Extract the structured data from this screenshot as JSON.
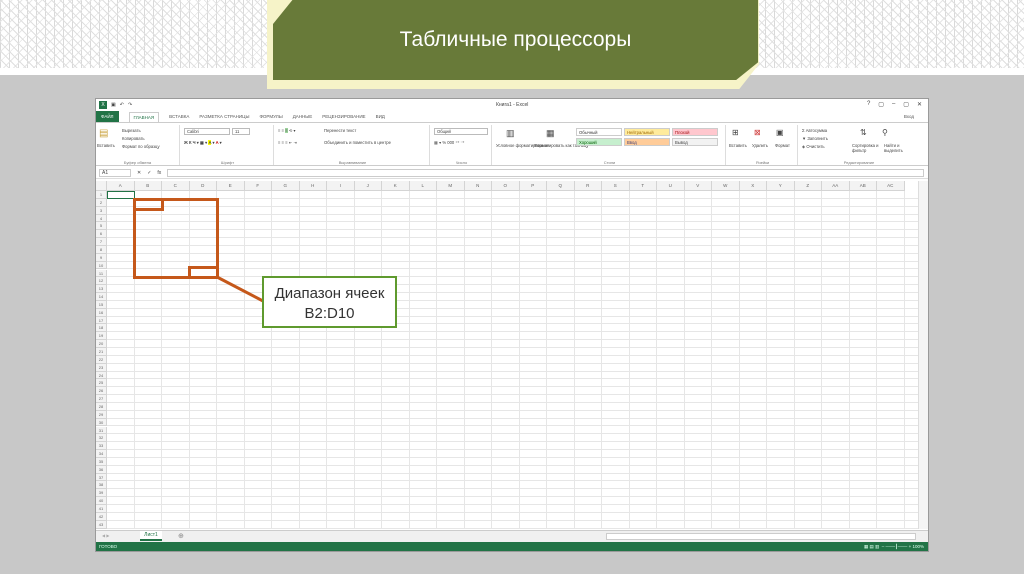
{
  "slide": {
    "title": "Табличные процессоры"
  },
  "excel": {
    "window_title": "Книга1 - Excel",
    "window_controls": [
      "?",
      "▢",
      "–",
      "▢",
      "✕"
    ],
    "user": "Вход",
    "tabs": [
      "ФАЙЛ",
      "ГЛАВНАЯ",
      "ВСТАВКА",
      "РАЗМЕТКА СТРАНИЦЫ",
      "ФОРМУЛЫ",
      "ДАННЫЕ",
      "РЕЦЕНЗИРОВАНИЕ",
      "ВИД"
    ],
    "ribbon": {
      "clipboard": {
        "paste": "Вставить",
        "cut": "Вырезать",
        "copy": "Копировать",
        "format_painter": "Формат по образцу",
        "label": "Буфер обмена"
      },
      "font": {
        "name": "Calibri",
        "size": "11",
        "label": "Шрифт"
      },
      "alignment": {
        "wrap": "Перенести текст",
        "merge": "Объединить и поместить в центре",
        "label": "Выравнивание"
      },
      "number": {
        "format": "Общий",
        "label": "Число"
      },
      "styles": {
        "conditional": "Условное форматирование",
        "as_table": "Форматировать как таблицу",
        "cells": [
          {
            "name": "Обычный",
            "bg": "#ffffff",
            "fg": "#333333"
          },
          {
            "name": "Нейтральный",
            "bg": "#ffeb9c",
            "fg": "#9c6500"
          },
          {
            "name": "Плохой",
            "bg": "#ffc7ce",
            "fg": "#9c0006"
          },
          {
            "name": "Хороший",
            "bg": "#c6efce",
            "fg": "#006100"
          },
          {
            "name": "Ввод",
            "bg": "#ffcc99",
            "fg": "#3f3f76"
          },
          {
            "name": "Вывод",
            "bg": "#f2f2f2",
            "fg": "#3f3f3f"
          }
        ],
        "label": "Стили"
      },
      "cells": {
        "insert": "Вставить",
        "delete": "Удалить",
        "format": "Формат",
        "label": "Ячейки"
      },
      "editing": {
        "autosum": "Автосумма",
        "fill": "Заполнить",
        "clear": "Очистить",
        "sort": "Сортировка и фильтр",
        "find": "Найти и выделить",
        "label": "Редактирование"
      }
    },
    "name_box": "A1",
    "formula_symbols": [
      "✕",
      "✓",
      "fx"
    ],
    "columns": [
      "A",
      "B",
      "C",
      "D",
      "E",
      "F",
      "G",
      "H",
      "I",
      "J",
      "K",
      "L",
      "M",
      "N",
      "O",
      "P",
      "Q",
      "R",
      "S",
      "T",
      "U",
      "V",
      "W",
      "X",
      "Y",
      "Z",
      "AA",
      "AB",
      "AC"
    ],
    "row_count": 43,
    "sheet_tab": "Лист1",
    "status": "ГОТОВО",
    "zoom": "100%"
  },
  "callout": {
    "line1": "Диапазон ячеек",
    "line2": "B2:D10"
  }
}
